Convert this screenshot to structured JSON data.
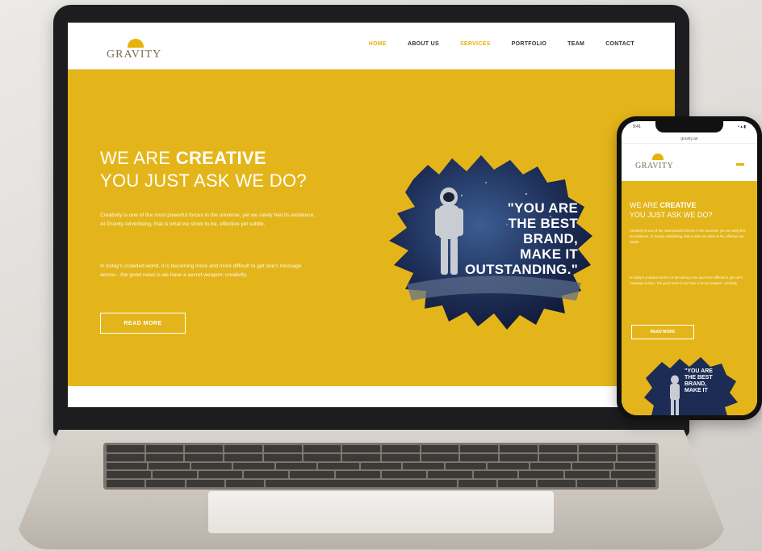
{
  "site": {
    "logo_text": "GRAVITY",
    "nav": [
      "HOME",
      "ABOUT US",
      "SERVICES",
      "PORTFOLIO",
      "TEAM",
      "CONTACT"
    ],
    "hero": {
      "heading_light": "WE ARE ",
      "heading_bold": "CREATIVE",
      "heading_line2": "YOU JUST ASK WE DO?",
      "paragraph1": "Creativity is one of the most powerful forces in the universe, yet we rarely feel its existence. At Gravity Advertising, that is what we strive to be, effective yet subtle.",
      "paragraph2": "In today's crowded world, it is becoming more and more difficult to get one's message across - the good news is we have a secret weapon: creativity.",
      "button_label": "READ MORE",
      "quote": "\"YOU ARE\nTHE BEST\nBRAND,\nMAKE IT\nOUTSTANDING.\""
    }
  },
  "mobile": {
    "status_time": "9:41",
    "status_icons": "▪ ▴ ▮",
    "url": "gravity.ae",
    "logo_text": "GRAVITY",
    "heading_light": "WE ARE ",
    "heading_bold": "CREATIVE",
    "heading_line2": "YOU JUST ASK WE DO?",
    "paragraph1": "Creativity is one of the most powerful forces in the universe, yet we rarely feel its existence. At Gravity Advertising, that is what we strive to be, effective yet subtle.",
    "paragraph2": "In today's crowded world, it is becoming more and more difficult to get one's message across - the good news is we have a secret weapon: creativity.",
    "button_label": "READ MORE",
    "quote": "\"YOU ARE\nTHE BEST\nBRAND,\nMAKE IT"
  },
  "colors": {
    "accent": "#e4b51a",
    "logo_sun": "#e7b10a",
    "night_sky": "#1c2c54"
  }
}
